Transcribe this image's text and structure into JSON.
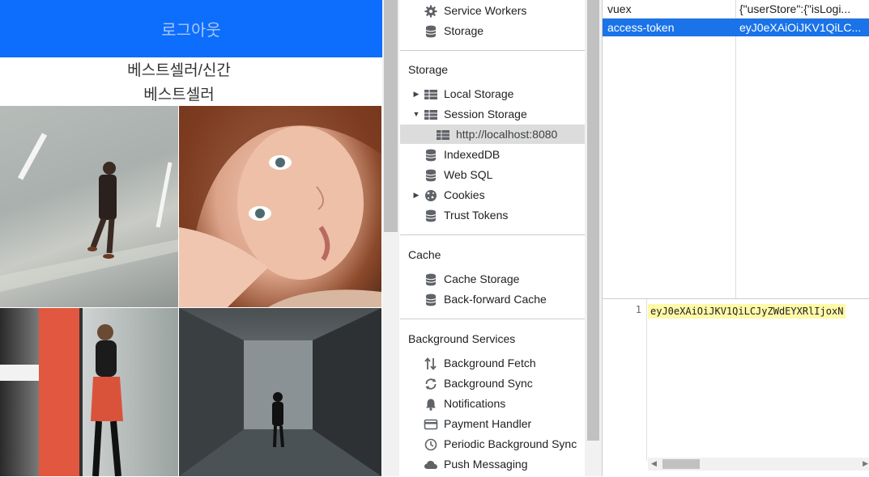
{
  "webpage": {
    "logout_label": "로그아웃",
    "section_title_1": "베스트셀러/신간",
    "section_title_2": "베스트셀러"
  },
  "app_panel": {
    "top_items": [
      {
        "label": "Service Workers",
        "icon": "gear-icon"
      },
      {
        "label": "Storage",
        "icon": "database-icon"
      }
    ],
    "storage_header": "Storage",
    "storage_items": [
      {
        "label": "Local Storage",
        "icon": "grid-icon",
        "expanded": false
      },
      {
        "label": "Session Storage",
        "icon": "grid-icon",
        "expanded": true
      },
      {
        "label": "http://localhost:8080",
        "icon": "grid-icon",
        "selected": true
      },
      {
        "label": "IndexedDB",
        "icon": "database-icon"
      },
      {
        "label": "Web SQL",
        "icon": "database-icon"
      },
      {
        "label": "Cookies",
        "icon": "cookie-icon",
        "expanded": false
      },
      {
        "label": "Trust Tokens",
        "icon": "database-icon"
      }
    ],
    "cache_header": "Cache",
    "cache_items": [
      {
        "label": "Cache Storage",
        "icon": "database-icon"
      },
      {
        "label": "Back-forward Cache",
        "icon": "database-icon"
      }
    ],
    "background_header": "Background Services",
    "background_items": [
      {
        "label": "Background Fetch",
        "icon": "fetch-arrows-icon"
      },
      {
        "label": "Background Sync",
        "icon": "sync-icon"
      },
      {
        "label": "Notifications",
        "icon": "bell-icon"
      },
      {
        "label": "Payment Handler",
        "icon": "credit-card-icon"
      },
      {
        "label": "Periodic Background Sync",
        "icon": "clock-icon"
      },
      {
        "label": "Push Messaging",
        "icon": "cloud-icon"
      }
    ]
  },
  "storage_table": {
    "rows": [
      {
        "key": "vuex",
        "value": "{\"userStore\":{\"isLogi..."
      },
      {
        "key": "access-token",
        "value": "eyJ0eXAiOiJKV1QiLC...",
        "selected": true
      }
    ]
  },
  "preview": {
    "line_number": "1",
    "code": "eyJ0eXAiOiJKV1QiLCJyZWdEYXRlIjoxN"
  },
  "colors": {
    "accent_blue": "#0d6efd",
    "selection_blue": "#1a73e8",
    "highlight_yellow": "#fff9a8"
  }
}
